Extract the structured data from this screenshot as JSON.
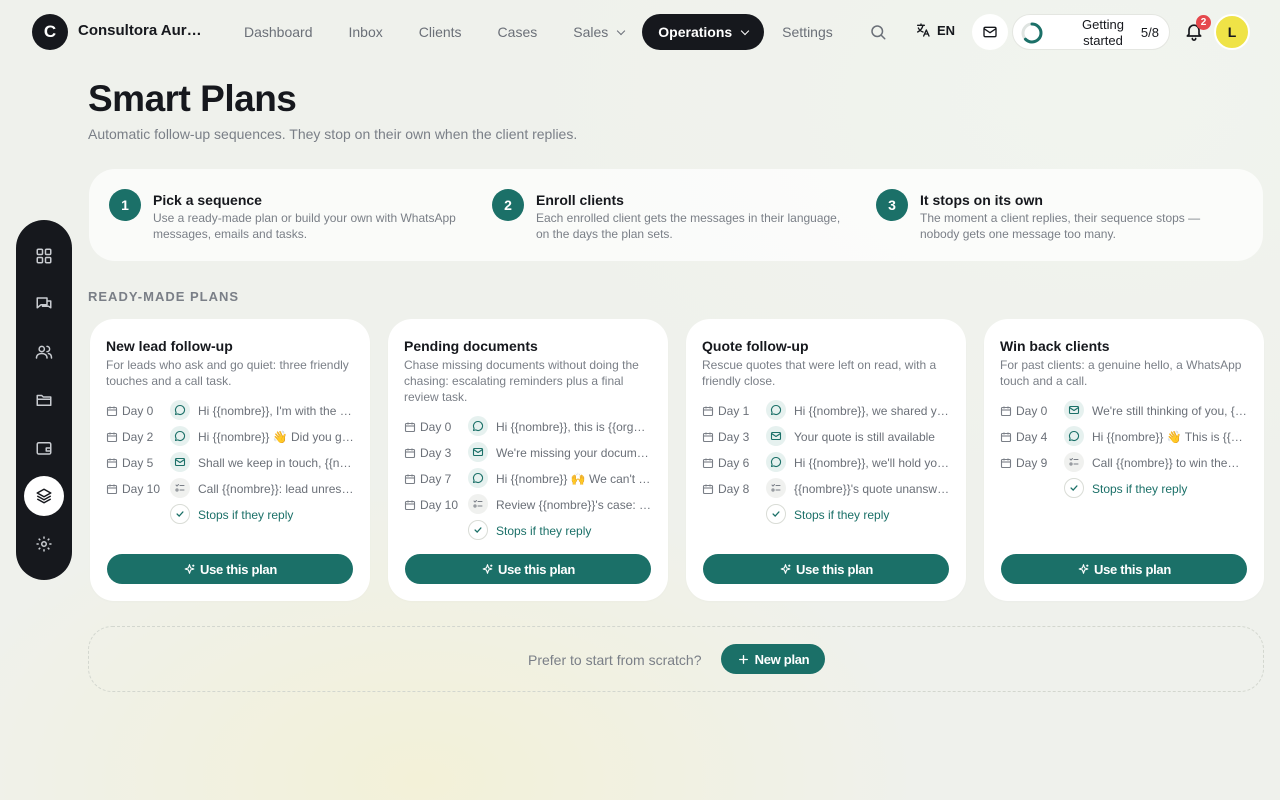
{
  "brand": {
    "initial": "C",
    "name": "Consultora Aurora"
  },
  "nav": [
    {
      "label": "Dashboard",
      "active": false,
      "dropdown": false
    },
    {
      "label": "Inbox",
      "active": false,
      "dropdown": false
    },
    {
      "label": "Clients",
      "active": false,
      "dropdown": false
    },
    {
      "label": "Cases",
      "active": false,
      "dropdown": false
    },
    {
      "label": "Sales",
      "active": false,
      "dropdown": true
    },
    {
      "label": "Operations",
      "active": true,
      "dropdown": true
    },
    {
      "label": "Settings",
      "active": false,
      "dropdown": false
    }
  ],
  "language": {
    "code": "EN",
    "icon": "translate-icon"
  },
  "getting_started": {
    "label": "Getting started",
    "count": "5/8",
    "progress": 0.625
  },
  "notifications": {
    "count": "2"
  },
  "user": {
    "initial": "L"
  },
  "colors": {
    "accent": "#1b7068",
    "dark": "#16181d",
    "avatar": "#efe347",
    "badge": "#e5484d"
  },
  "rail": [
    {
      "icon": "dashboard-icon",
      "active": false
    },
    {
      "icon": "chat-icon",
      "active": false
    },
    {
      "icon": "users-icon",
      "active": false
    },
    {
      "icon": "folder-icon",
      "active": false
    },
    {
      "icon": "wallet-icon",
      "active": false
    },
    {
      "icon": "layers-icon",
      "active": true
    },
    {
      "icon": "gear-icon",
      "active": false
    }
  ],
  "page": {
    "title": "Smart Plans",
    "subtitle": "Automatic follow-up sequences. They stop on their own when the client replies."
  },
  "steps": [
    {
      "num": "1",
      "title": "Pick a sequence",
      "desc": "Use a ready-made plan or build your own with WhatsApp messages, emails and tasks."
    },
    {
      "num": "2",
      "title": "Enroll clients",
      "desc": "Each enrolled client gets the messages in their language, on the days the plan sets."
    },
    {
      "num": "3",
      "title": "It stops on its own",
      "desc": "The moment a client replies, their sequence stops — nobody gets one message too many."
    }
  ],
  "section_label": "READY-MADE PLANS",
  "plans": [
    {
      "title": "New lead follow-up",
      "desc": "For leads who ask and go quiet: three friendly touches and a call task.",
      "touches": [
        {
          "day": "Day 0",
          "channel": "whatsapp",
          "text": "Hi {{nombre}}, I'm with the {{organizacion}} team"
        },
        {
          "day": "Day 2",
          "channel": "whatsapp",
          "text": "Hi {{nombre}} 👋 Did you get a chance to look"
        },
        {
          "day": "Day 5",
          "channel": "email",
          "text": "Shall we keep in touch, {{nombre}}?"
        },
        {
          "day": "Day 10",
          "channel": "task",
          "text": "Call {{nombre}}: lead unresponsive"
        }
      ],
      "stops_label": "Stops if they reply",
      "button": "Use this plan"
    },
    {
      "title": "Pending documents",
      "desc": "Chase missing documents without doing the chasing: escalating reminders plus a final review task.",
      "touches": [
        {
          "day": "Day 0",
          "channel": "whatsapp",
          "text": "Hi {{nombre}}, this is {{organizacion}}"
        },
        {
          "day": "Day 3",
          "channel": "email",
          "text": "We're missing your documents"
        },
        {
          "day": "Day 7",
          "channel": "whatsapp",
          "text": "Hi {{nombre}} 🙌 We can't move forward"
        },
        {
          "day": "Day 10",
          "channel": "task",
          "text": "Review {{nombre}}'s case: documents"
        }
      ],
      "stops_label": "Stops if they reply",
      "button": "Use this plan"
    },
    {
      "title": "Quote follow-up",
      "desc": "Rescue quotes that were left on read, with a friendly close.",
      "touches": [
        {
          "day": "Day 1",
          "channel": "whatsapp",
          "text": "Hi {{nombre}}, we shared your quote"
        },
        {
          "day": "Day 3",
          "channel": "email",
          "text": "Your quote is still available"
        },
        {
          "day": "Day 6",
          "channel": "whatsapp",
          "text": "Hi {{nombre}}, we'll hold your price"
        },
        {
          "day": "Day 8",
          "channel": "task",
          "text": "{{nombre}}'s quote unanswered"
        }
      ],
      "stops_label": "Stops if they reply",
      "button": "Use this plan"
    },
    {
      "title": "Win back clients",
      "desc": "For past clients: a genuine hello, a WhatsApp touch and a call.",
      "touches": [
        {
          "day": "Day 0",
          "channel": "email",
          "text": "We're still thinking of you, {{nombre}}"
        },
        {
          "day": "Day 4",
          "channel": "whatsapp",
          "text": "Hi {{nombre}} 👋 This is {{organizacion}}"
        },
        {
          "day": "Day 9",
          "channel": "task",
          "text": "Call {{nombre}} to win them back"
        }
      ],
      "stops_label": "Stops if they reply",
      "button": "Use this plan"
    }
  ],
  "scratch": {
    "text": "Prefer to start from scratch?",
    "button": "New plan"
  }
}
